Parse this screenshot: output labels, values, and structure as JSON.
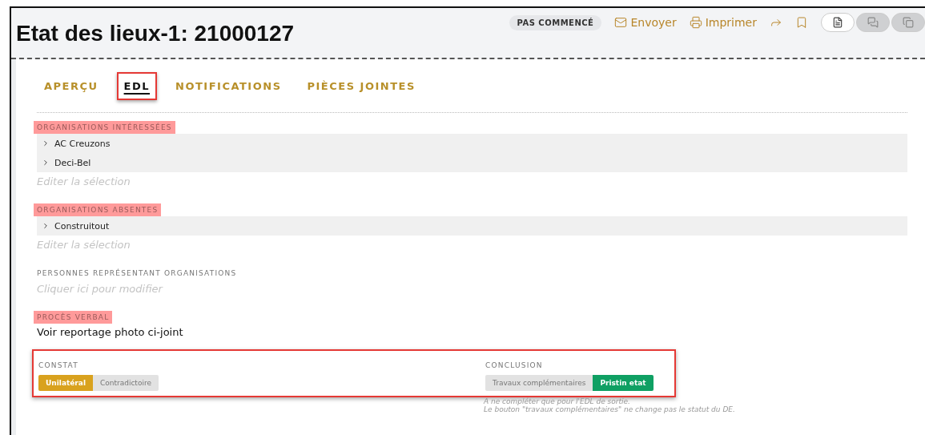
{
  "header": {
    "title": "Etat des lieux-1: 21000127",
    "status": "PAS COMMENCÉ",
    "actions": [
      {
        "kind": "send",
        "label": "Envoyer"
      },
      {
        "kind": "print",
        "label": "Imprimer"
      },
      {
        "kind": "share"
      },
      {
        "kind": "bookmark"
      }
    ],
    "views": [
      {
        "kind": "document",
        "selected": true
      },
      {
        "kind": "comments",
        "selected": false
      },
      {
        "kind": "history",
        "selected": false
      }
    ]
  },
  "tabs": [
    {
      "label": "APERÇU",
      "selected": false,
      "annotated": false
    },
    {
      "label": "EDL",
      "selected": true,
      "annotated": true
    },
    {
      "label": "NOTIFICATIONS",
      "selected": false,
      "annotated": false
    },
    {
      "label": "PIÈCES JOINTES",
      "selected": false,
      "annotated": false
    }
  ],
  "sections": [
    {
      "kind": "list",
      "label": "ORGANISATIONS INTÉRESSÉES",
      "highlighted": true,
      "items": [
        "AC Creuzons",
        "Deci-Bel"
      ],
      "link": "Editer la sélection"
    },
    {
      "kind": "list",
      "label": "ORGANISATIONS ABSENTES",
      "highlighted": true,
      "items": [
        "Construitout"
      ],
      "link": "Editer la sélection"
    },
    {
      "kind": "link",
      "label": "PERSONNES REPRÉSENTANT ORGANISATIONS",
      "highlighted": false,
      "link": "Cliquer ici pour modifier"
    },
    {
      "kind": "text",
      "label": "PROCÈS VERBAL",
      "highlighted": true,
      "text": "Voir reportage photo ci-joint"
    }
  ],
  "choices": {
    "annotated": true,
    "constat": {
      "label": "CONSTAT",
      "color": "#d9a21e",
      "options": [
        {
          "label": "Unilatéral",
          "selected": true
        },
        {
          "label": "Contradictoire",
          "selected": false
        }
      ]
    },
    "conclusion": {
      "label": "CONCLUSION",
      "color": "#0fa063",
      "options": [
        {
          "label": "Travaux complémentaires",
          "selected": false
        },
        {
          "label": "Pristin etat",
          "selected": true
        }
      ],
      "notes": [
        "A ne compléter que pour l'EDL de sortie.",
        "Le bouton \"travaux complémentaires\" ne change pas le statut du DE."
      ]
    }
  }
}
